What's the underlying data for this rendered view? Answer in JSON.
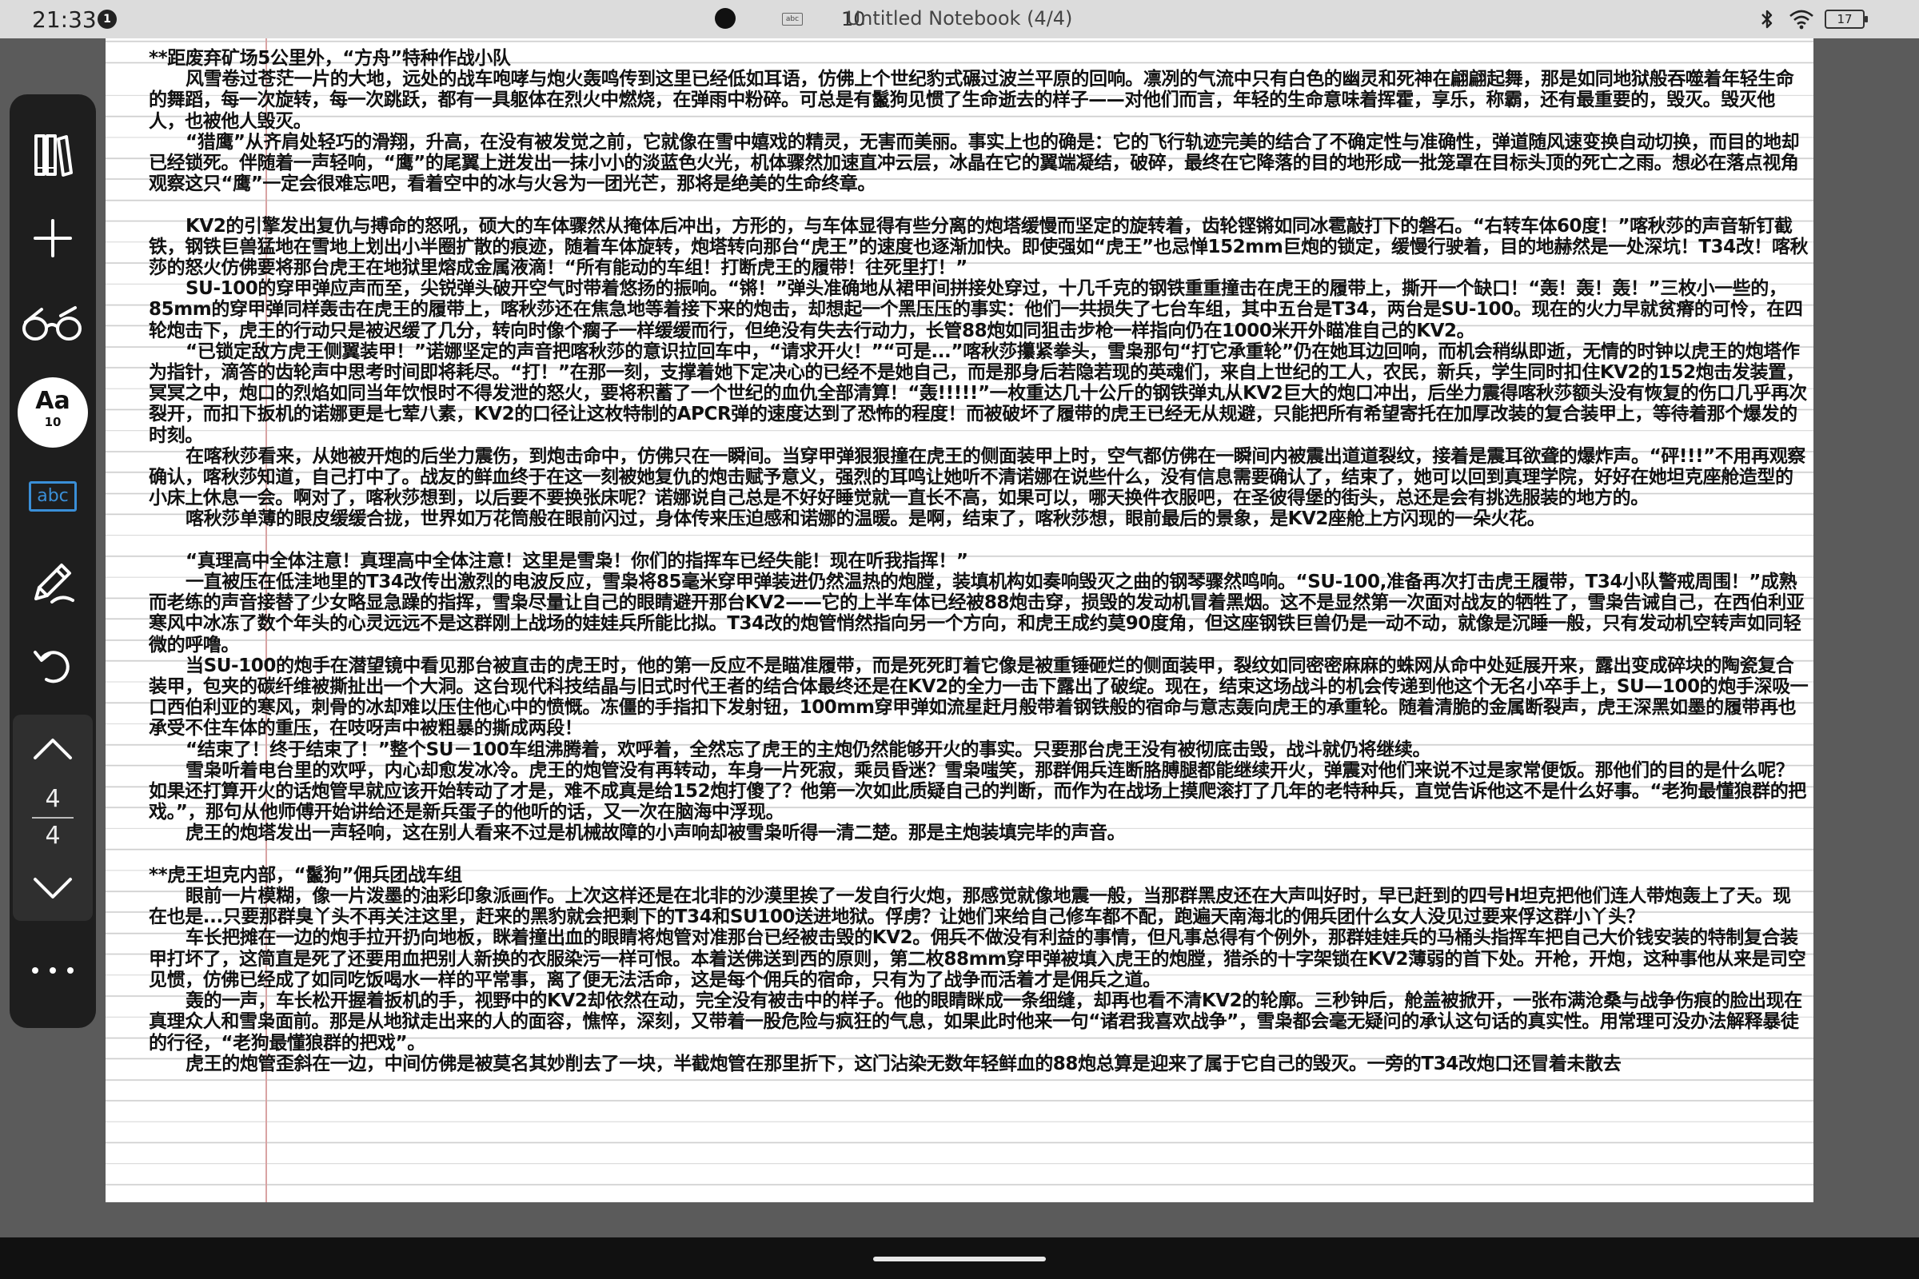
{
  "status_bar": {
    "time": "21:33",
    "notification_count": "1",
    "abc_label": "abc",
    "font_size": "10",
    "title": "Untitled Notebook (4/4)",
    "battery": "17"
  },
  "toolbar": {
    "font_label": "Aa",
    "font_size": "10",
    "abc_label": "abc",
    "page_current": "4",
    "page_total": "4",
    "icons": [
      "library-icon",
      "add-icon",
      "reading-glasses-icon",
      "font-icon",
      "abc-icon",
      "pen-icon",
      "undo-icon",
      "chevron-up-icon",
      "chevron-down-icon",
      "more-icon"
    ]
  },
  "page": {
    "paragraphs": [
      "**距废弃矿场5公里外，“方舟”特种作战小队",
      "风雪卷过苍茫一片的大地，远处的战车咆哮与炮火轰鸣传到这里已经低如耳语，仿佛上个世纪豹式碾过波兰平原的回响。凛冽的气流中只有白色的幽灵和死神在翩翩起舞，那是如同地狱般吞噬着年轻生命的舞蹈，每一次旋转，每一次跳跃，都有一具躯体在烈火中燃烧，在弹雨中粉碎。可总是有鬣狗见惯了生命逝去的样子——对他们而言，年轻的生命意味着挥霍，享乐，称霸，还有最重要的，毁灭。毁灭他人，也被他人毁灭。",
      "“猎鹰”从齐肩处轻巧的滑翔，升高，在没有被发觉之前，它就像在雪中嬉戏的精灵，无害而美丽。事实上也的确是：它的飞行轨迹完美的结合了不确定性与准确性，弹道随风速变换自动切换，而目的地却已经锁死。伴随着一声轻响，“鹰”的尾翼上迸发出一抹小小的淡蓝色火光，机体骤然加速直冲云层，冰晶在它的翼端凝结，破碎，最终在它降落的目的地形成一批笼罩在目标头顶的死亡之雨。想必在落点视角观察这只“鹰”一定会很难忘吧，看着空中的冰与火융为一团光芒，那将是绝美的生命终章。",
      "",
      "KV2的引擎发出复仇与搏命的怒吼，硕大的车体骤然从掩体后冲出，方形的，与车体显得有些分离的炮塔缓慢而坚定的旋转着，齿轮铿锵如同冰雹敲打下的磐石。“右转车体60度！”喀秋莎的声音斩钉截铁，钢铁巨兽猛地在雪地上划出小半圈扩散的痕迹，随着车体旋转，炮塔转向那台“虎王”的速度也逐渐加快。即使强如“虎王”也忌惮152mm巨炮的锁定，缓慢行驶着，目的地赫然是一处深坑！T34改！喀秋莎的怒火仿佛要将那台虎王在地狱里熔成金属液滴！“所有能动的车组！打断虎王的履带！往死里打！”",
      "SU-100的穿甲弹应声而至，尖锐弹头破开空气时带着悠扬的振响。“锵！”弹头准确地从裙甲间拼接处穿过，十几千克的钢铁重重撞击在虎王的履带上，撕开一个缺口！“轰！轰！轰！”三枚小一些的，85mm的穿甲弹同样轰击在虎王的履带上，喀秋莎还在焦急地等着接下来的炮击，却想起一个黑压压的事实：他们一共损失了七台车组，其中五台是T34，两台是SU-100。现在的火力早就贫瘠的可怜，在四轮炮击下，虎王的行动只是被迟缓了几分，转向时像个瘸子一样缓缓而行，但绝没有失去行动力，长管88炮如同狙击步枪一样指向仍在1000米开外瞄准自己的KV2。",
      "“已锁定敌方虎王侧翼装甲！”诺娜坚定的声音把喀秋莎的意识拉回车中，“请求开火！”“可是...”喀秋莎攥紧拳头，雪枭那句“打它承重轮”仍在她耳边回响，而机会稍纵即逝，无情的时钟以虎王的炮塔作为指针，滴答的齿轮声中思考时间即将耗尽。“打！”在那一刻，支撑着她下定决心的已经不是她自己，而是那身后若隐若现的英魂们，来自上世纪的工人，农民，新兵，学生同时扣住KV2的152炮击发装置，冥冥之中，炮口的烈焰如同当年饮恨时不得发泄的怒火，要将积蓄了一个世纪的血仇全部清算！“轰!!!!!”一枚重达几十公斤的钢铁弹丸从KV2巨大的炮口冲出，后坐力震得喀秋莎额头没有恢复的伤口几乎再次裂开，而扣下扳机的诺娜更是七荤八素，KV2的口径让这枚特制的APCR弹的速度达到了恐怖的程度！而被破坏了履带的虎王已经无从规避，只能把所有希望寄托在加厚改装的复合装甲上，等待着那个爆发的时刻。",
      "在喀秋莎看来，从她被开炮的后坐力震伤，到炮击命中，仿佛只在一瞬间。当穿甲弹狠狠撞在虎王的侧面装甲上时，空气都仿佛在一瞬间内被震出道道裂纹，接着是震耳欲聋的爆炸声。“砰!!!”不用再观察确认，喀秋莎知道，自己打中了。战友的鲜血终于在这一刻被她复仇的炮击赋予意义，强烈的耳鸣让她听不清诺娜在说些什么，没有信息需要确认了，结束了，她可以回到真理学院，好好在她坦克座舱造型的小床上休息一会。啊对了，喀秋莎想到，以后要不要换张床呢？诺娜说自己总是不好好睡觉就一直长不高，如果可以，哪天换件衣服吧，在圣彼得堡的街头，总还是会有挑选服装的地方的。",
      "喀秋莎单薄的眼皮缓缓合拢，世界如万花筒般在眼前闪过，身体传来压迫感和诺娜的温暖。是啊，结束了，喀秋莎想，眼前最后的景象，是KV2座舱上方闪现的一朵火花。",
      "",
      "“真理高中全体注意！真理高中全体注意！这里是雪枭！你们的指挥车已经失能！现在听我指挥！”",
      "一直被压在低洼地里的T34改传出激烈的电波反应，雪枭将85毫米穿甲弹装进仍然温热的炮膛，装填机构如奏响毁灭之曲的钢琴骤然鸣响。“SU-100,准备再次打击虎王履带，T34小队警戒周围！”成熟而老练的声音接替了少女略显急躁的指挥，雪枭尽量让自己的眼睛避开那台KV2——它的上半车体已经被88炮击穿，损毁的发动机冒着黑烟。这不是显然第一次面对战友的牺牲了，雪枭告诫自己，在西伯利亚寒风中冰冻了数个年头的心灵远远不是这群刚上战场的娃娃兵所能比拟。T34改的炮管悄然指向另一个方向，和虎王成约莫90度角，但这座钢铁巨兽仍是一动不动，就像是沉睡一般，只有发动机空转声如同轻微的呼噜。",
      "当SU-100的炮手在潜望镜中看见那台被直击的虎王时，他的第一反应不是瞄准履带，而是死死盯着它像是被重锤砸烂的侧面装甲，裂纹如同密密麻麻的蛛网从命中处延展开来，露出变成碎块的陶瓷复合装甲，包夹的碳纤维被撕扯出一个大洞。这台现代科技结晶与旧式时代王者的结合体最终还是在KV2的全力一击下露出了破绽。现在，结束这场战斗的机会传递到他这个无名小卒手上，SU—100的炮手深吸一口西伯利亚的寒风，刺骨的冰却难以压住他心中的愤慨。冻僵的手指扣下发射钮，100mm穿甲弹如流星赶月般带着钢铁般的宿命与意志轰向虎王的承重轮。随着清脆的金属断裂声，虎王深黑如墨的履带再也承受不住车体的重压，在吱呀声中被粗暴的撕成两段！",
      "“结束了！终于结束了！”整个SU－100车组沸腾着，欢呼着，全然忘了虎王的主炮仍然能够开火的事实。只要那台虎王没有被彻底击毁，战斗就仍将继续。",
      "雪枭听着电台里的欢呼，内心却愈发冰冷。虎王的炮管没有再转动，车身一片死寂，乘员昏迷？雪枭嗤笑，那群佣兵连断胳膊腿都能继续开火，弹震对他们来说不过是家常便饭。那他们的目的是什么呢？如果还打算开火的话炮管早就应该开始转动了才是，难不成真是给152炮打傻了？他第一次如此质疑自己的判断，而作为在战场上摸爬滚打了几年的老特种兵，直觉告诉他这不是什么好事。“老狗最懂狼群的把戏。”，那句从他师傅开始讲给还是新兵蛋子的他听的话，又一次在脑海中浮现。",
      "虎王的炮塔发出一声轻响，这在别人看来不过是机械故障的小声响却被雪枭听得一清二楚。那是主炮装填完毕的声音。",
      "",
      "**虎王坦克内部，“鬣狗”佣兵团战车组",
      "眼前一片模糊，像一片泼墨的油彩印象派画作。上次这样还是在北非的沙漠里挨了一发自行火炮，那感觉就像地震一般，当那群黑皮还在大声叫好时，早已赶到的四号H坦克把他们连人带炮轰上了天。现在也是...只要那群臭丫头不再关注这里，赶来的黑豹就会把剩下的T34和SU100送进地狱。俘虏？让她们来给自己修车都不配，跑遍天南海北的佣兵团什么女人没见过要来俘这群小丫头？",
      "车长把摊在一边的炮手拉开扔向地板，眯着撞出血的眼睛将炮管对准那台已经被击毁的KV2。佣兵不做没有利益的事情，但凡事总得有个例外，那群娃娃兵的马桶头指挥车把自己大价钱安装的特制复合装甲打坏了，这简直是死了还要用血把别人新换的衣服染污一样可恨。本着送佛送到西的原则，第二枚88mm穿甲弹被填入虎王的炮膛，猎杀的十字架锁在KV2薄弱的首下处。开枪，开炮，这种事他从来是司空见惯，仿佛已经成了如同吃饭喝水一样的平常事，离了便无法活命，这是每个佣兵的宿命，只有为了战争而活着才是佣兵之道。",
      "轰的一声，车长松开握着扳机的手，视野中的KV2却依然在动，完全没有被击中的样子。他的眼睛眯成一条细缝，却再也看不清KV2的轮廓。三秒钟后，舱盖被掀开，一张布满沧桑与战争伤痕的脸出现在真理众人和雪枭面前。那是从地狱走出来的人的面容，憔悴，深刻，又带着一股危险与疯狂的气息，如果此时他来一句“诸君我喜欢战争”，雪枭都会毫无疑问的承认这句话的真实性。用常理可没办法解释暴徒的行径，“老狗最懂狼群的把戏”。",
      "虎王的炮管歪斜在一边，中间仿佛是被莫名其妙削去了一块，半截炮管在那里折下，这门沾染无数年轻鲜血的88炮总算是迎来了属于它自己的毁灭。一旁的T34改炮口还冒着未散去"
    ]
  }
}
